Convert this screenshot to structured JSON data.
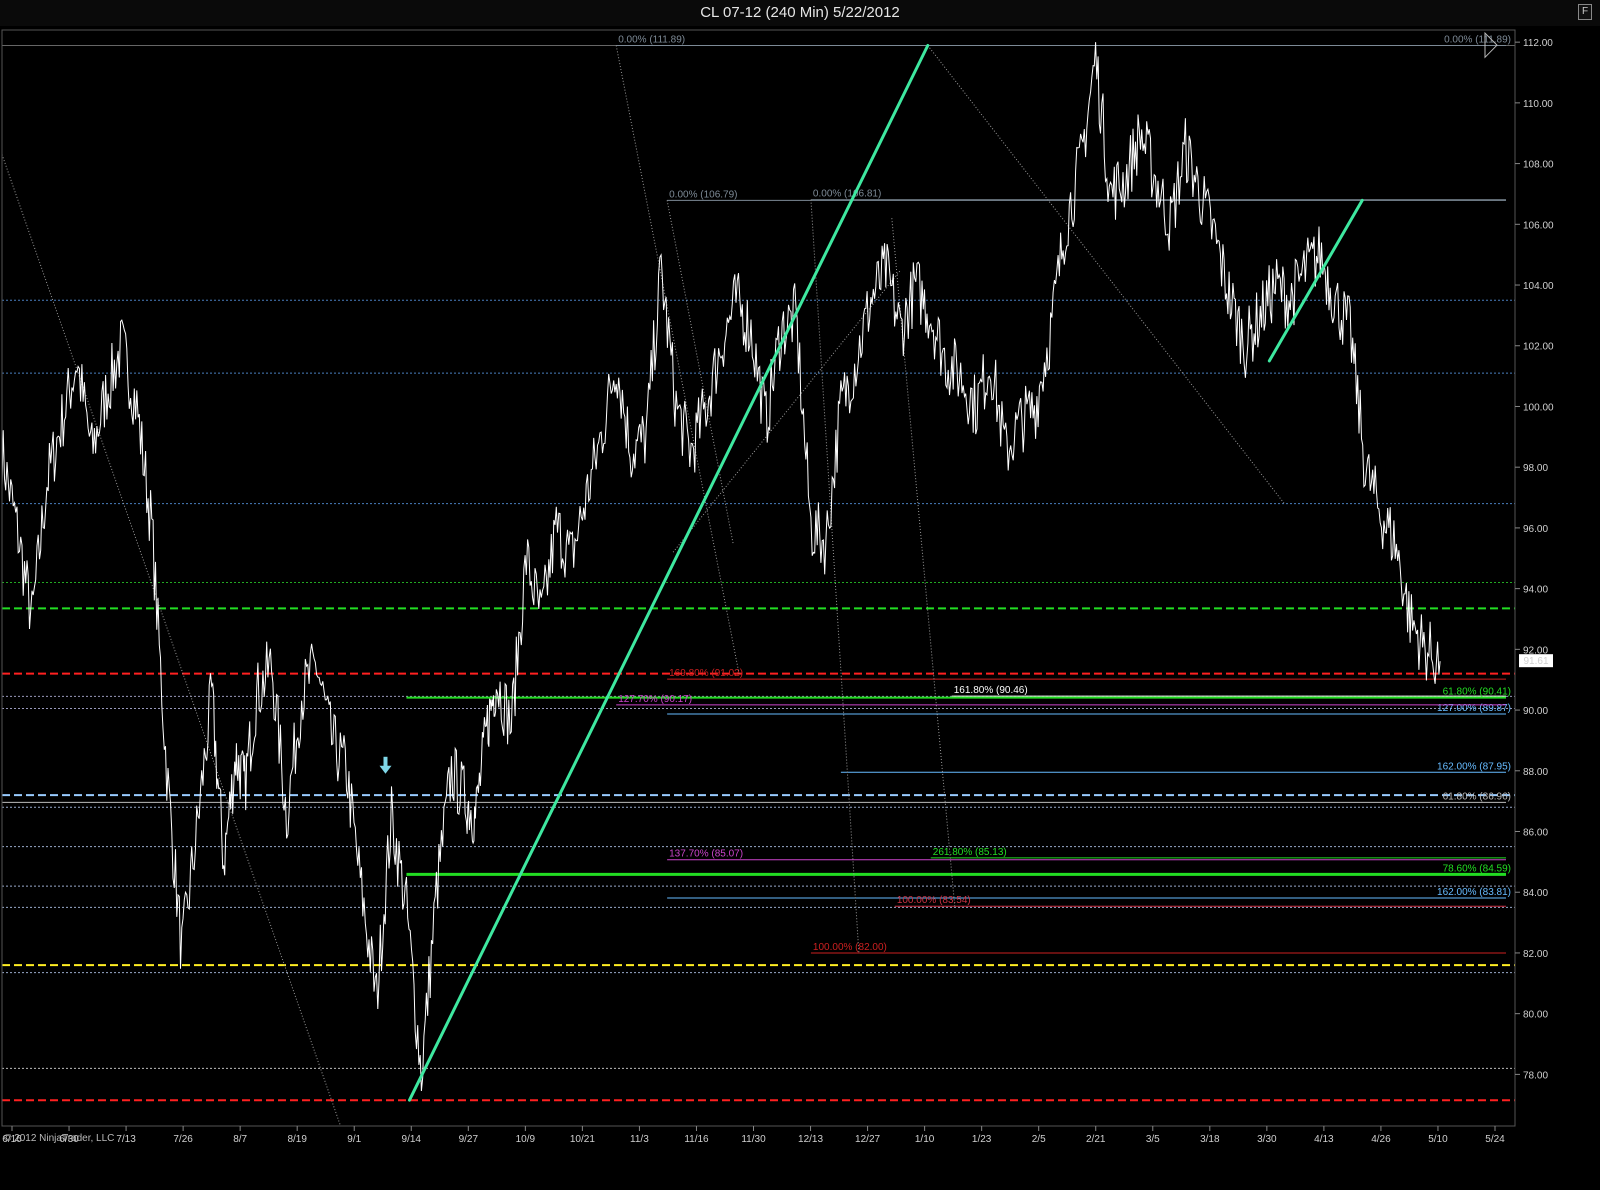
{
  "window": {
    "title": "CL 07-12 (240 Min)  5/22/2012",
    "button_label": "F"
  },
  "copyright": "© 2012 NinjaTrader, LLC",
  "colors": {
    "background": "#000000",
    "price": "#ffffff",
    "trendline": "#3ee8a0",
    "red": "#ff2020",
    "green": "#22dd22",
    "yellow": "#ffee22",
    "blue": "#66bbff"
  },
  "chart_data": {
    "type": "line",
    "ylim": [
      76.3,
      112.4
    ],
    "y_ticks": [
      78,
      80,
      82,
      84,
      86,
      88,
      90,
      92,
      94,
      96,
      98,
      100,
      102,
      104,
      106,
      108,
      110,
      112
    ],
    "y_tick_labels": [
      "78.00",
      "80.00",
      "82.00",
      "84.00",
      "86.00",
      "88.00",
      "90.00",
      "92.00",
      "94.00",
      "96.00",
      "98.00",
      "100.00",
      "102.00",
      "104.00",
      "106.00",
      "108.00",
      "110.00",
      "112.00"
    ],
    "x_ticks": [
      0,
      2,
      4,
      6,
      8,
      10,
      12,
      14,
      16,
      18,
      20,
      22,
      24,
      26,
      28,
      30,
      32,
      34,
      36,
      38,
      40,
      42,
      44,
      46,
      48
    ],
    "x_tick_labels": [
      "6/16",
      "6/30",
      "7/13",
      "7/26",
      "8/7",
      "8/19",
      "9/1",
      "9/14",
      "9/27",
      "10/9",
      "10/21",
      "11/3",
      "11/16",
      "11/30",
      "12/13",
      "12/27",
      "1/10",
      "1/23",
      "2/5",
      "2/21",
      "3/5",
      "3/18",
      "3/30",
      "4/13",
      "4/26",
      "5/10",
      "5/24"
    ],
    "xlim": [
      0,
      50.5
    ],
    "last_price": "91.61",
    "price_series": {
      "x": [
        0,
        0.5,
        1.0,
        1.5,
        2.0,
        2.5,
        3.0,
        3.5,
        4.0,
        4.5,
        5.0,
        5.5,
        6.0,
        6.5,
        7.0,
        7.4,
        7.8,
        8.1,
        8.5,
        9.0,
        9.5,
        10.0,
        10.5,
        11.0,
        11.5,
        12.0,
        12.5,
        13.0,
        13.5,
        14.0,
        14.5,
        15.0,
        15.5,
        15.8,
        16.2,
        16.5,
        17.0,
        17.5,
        18.0,
        18.5,
        19.0,
        19.5,
        20.0,
        20.5,
        21.0,
        21.5,
        22.0,
        22.5,
        23.0,
        23.5,
        24.0,
        24.5,
        25.0,
        25.5,
        26.0,
        26.5,
        27.0,
        27.5,
        28.0,
        28.5,
        29.0,
        29.5,
        30.0,
        30.5,
        31.0,
        31.5,
        32.0,
        32.5,
        33.0,
        33.5,
        34.0,
        34.5,
        35.0,
        35.5,
        36.0,
        36.5,
        37.0,
        37.5,
        38.0,
        38.5,
        39.0,
        39.5,
        40.0,
        40.5,
        41.0,
        41.5,
        42.0,
        42.5,
        43.0,
        43.5,
        44.0,
        44.5,
        45.0,
        45.5,
        46.0,
        46.5,
        47.0,
        47.5,
        48.0
      ],
      "y": [
        98.5,
        96.0,
        93.0,
        97.5,
        99.5,
        101.5,
        98.5,
        100.5,
        102.0,
        100.0,
        96.0,
        88.0,
        82.0,
        86.0,
        90.5,
        85.0,
        88.5,
        87.5,
        90.5,
        91.5,
        86.5,
        90.5,
        91.5,
        89.0,
        88.0,
        84.0,
        80.5,
        86.5,
        83.5,
        78.0,
        84.0,
        88.0,
        87.0,
        86.5,
        89.5,
        91.0,
        89.5,
        95.0,
        93.0,
        96.0,
        95.0,
        97.0,
        99.0,
        101.5,
        98.5,
        99.0,
        104.5,
        100.0,
        98.5,
        100.0,
        102.0,
        103.5,
        102.5,
        99.5,
        102.5,
        103.0,
        96.0,
        95.5,
        100.0,
        101.5,
        103.5,
        104.5,
        102.5,
        104.0,
        103.0,
        101.5,
        101.0,
        100.0,
        101.5,
        98.5,
        99.5,
        100.0,
        102.5,
        106.0,
        108.0,
        111.5,
        107.0,
        107.5,
        109.0,
        107.5,
        106.0,
        108.5,
        107.0,
        105.5,
        103.5,
        102.0,
        103.0,
        104.0,
        103.5,
        104.5,
        105.0,
        103.5,
        102.5,
        98.0,
        96.5,
        95.5,
        93.0,
        92.0,
        91.61
      ]
    },
    "horizontal_lines": [
      {
        "y": 103.5,
        "color": "#4a7fbf",
        "style": "dotted",
        "width": 1
      },
      {
        "y": 101.1,
        "color": "#4a7fbf",
        "style": "dotted",
        "width": 1
      },
      {
        "y": 96.8,
        "color": "#4a7fbf",
        "style": "dotted",
        "width": 1
      },
      {
        "y": 94.2,
        "color": "#22aa22",
        "style": "dotted",
        "width": 1
      },
      {
        "y": 93.35,
        "color": "#22dd22",
        "style": "dashed",
        "width": 2
      },
      {
        "y": 91.2,
        "color": "#ff2020",
        "style": "dashed",
        "width": 2
      },
      {
        "y": 90.45,
        "color": "#9999bb",
        "style": "dotted",
        "width": 1
      },
      {
        "y": 90.05,
        "color": "#9999bb",
        "style": "dotted",
        "width": 1
      },
      {
        "y": 87.2,
        "color": "#99ccff",
        "style": "dashed",
        "width": 2
      },
      {
        "y": 86.8,
        "color": "#99aacc",
        "style": "dotted",
        "width": 1
      },
      {
        "y": 85.5,
        "color": "#99aacc",
        "style": "dotted",
        "width": 1
      },
      {
        "y": 84.2,
        "color": "#99aacc",
        "style": "dotted",
        "width": 1
      },
      {
        "y": 83.5,
        "color": "#99aacc",
        "style": "dotted",
        "width": 1
      },
      {
        "y": 81.6,
        "color": "#ffee22",
        "style": "dashed",
        "width": 2
      },
      {
        "y": 81.35,
        "color": "#99aacc",
        "style": "dotted",
        "width": 1
      },
      {
        "y": 78.2,
        "color": "#bbbbbb",
        "style": "dotted",
        "width": 1
      },
      {
        "y": 77.15,
        "color": "#ff2020",
        "style": "dashed",
        "width": 2
      },
      {
        "y": 111.89,
        "color": "#666666",
        "style": "solid",
        "width": 1
      }
    ],
    "fib_levels": [
      {
        "label": "0.00% (111.89)",
        "y": 111.89,
        "x_start": 20.5,
        "x_end": 50.2,
        "color": "#7d8a96",
        "label_pos": "start"
      },
      {
        "label": "0.00% (111.89)",
        "y": 111.89,
        "x_start": 40,
        "x_end": 50.2,
        "color": "#7d8a96",
        "label_pos": "end"
      },
      {
        "label": "0.00% (106.79)",
        "y": 106.79,
        "x_start": 22.2,
        "x_end": 50.2,
        "color": "#7d8a96",
        "label_pos": "start"
      },
      {
        "label": "0.00% (106.81)",
        "y": 106.81,
        "x_start": 27.0,
        "x_end": 50.2,
        "color": "#7d8a96",
        "label_pos": "start"
      },
      {
        "label": "169.80% (91.02)",
        "y": 91.02,
        "x_start": 22.2,
        "x_end": 50.2,
        "color": "#cc2020",
        "label_pos": "start"
      },
      {
        "label": "161.80% (90.46)",
        "y": 90.46,
        "x_start": 31.7,
        "x_end": 50.2,
        "color": "#ffffff",
        "label_pos": "start"
      },
      {
        "label": "61.80% (90.41)",
        "y": 90.41,
        "x_start": 13.5,
        "x_end": 50.2,
        "color": "#22dd22",
        "label_pos": "end",
        "width": 2
      },
      {
        "label": "127.00% (89.87)",
        "y": 89.87,
        "x_start": 22.2,
        "x_end": 50.2,
        "color": "#66bbff",
        "label_pos": "end"
      },
      {
        "label": "127.70% (90.17)",
        "y": 90.17,
        "x_start": 20.5,
        "x_end": 50.2,
        "color": "#cc44cc",
        "label_pos": "start"
      },
      {
        "label": "162.00% (87.95)",
        "y": 87.95,
        "x_start": 28.0,
        "x_end": 50.2,
        "color": "#66bbff",
        "label_pos": "end"
      },
      {
        "label": "61.80% (86.96)",
        "y": 86.96,
        "x_start": 0,
        "x_end": 50.2,
        "color": "#bbbbbb",
        "label_pos": "end"
      },
      {
        "label": "137.70% (85.07)",
        "y": 85.07,
        "x_start": 22.2,
        "x_end": 50.2,
        "color": "#cc44cc",
        "label_pos": "start"
      },
      {
        "label": "261.80% (85.13)",
        "y": 85.13,
        "x_start": 31.0,
        "x_end": 50.2,
        "color": "#22dd22",
        "label_pos": "start"
      },
      {
        "label": "78.60% (84.59)",
        "y": 84.59,
        "x_start": 13.5,
        "x_end": 50.2,
        "color": "#22dd22",
        "label_pos": "end",
        "width": 3
      },
      {
        "label": "162.00% (83.81)",
        "y": 83.81,
        "x_start": 22.2,
        "x_end": 50.2,
        "color": "#66bbff",
        "label_pos": "end"
      },
      {
        "label": "100.00% (83.54)",
        "y": 83.54,
        "x_start": 29.8,
        "x_end": 50.2,
        "color": "#cc3344",
        "label_pos": "start"
      },
      {
        "label": "100.00% (82.00)",
        "y": 82.0,
        "x_start": 27.0,
        "x_end": 50.2,
        "color": "#cc2020",
        "label_pos": "start"
      }
    ],
    "trendlines": [
      {
        "x1": 13.6,
        "y1": 77.15,
        "x2": 30.9,
        "y2": 111.89,
        "color": "#3ee8a0",
        "width": 3
      },
      {
        "x1": 42.3,
        "y1": 101.5,
        "x2": 45.4,
        "y2": 106.79,
        "color": "#3ee8a0",
        "width": 3
      }
    ],
    "thin_lines": [
      {
        "x1": 0,
        "y1": 108.3,
        "x2": 11.3,
        "y2": 76.3
      },
      {
        "x1": 20.5,
        "y1": 111.89,
        "x2": 24.6,
        "y2": 91.2
      },
      {
        "x1": 22.2,
        "y1": 106.79,
        "x2": 24.4,
        "y2": 95.5
      },
      {
        "x1": 27.0,
        "y1": 106.81,
        "x2": 28.6,
        "y2": 82.0
      },
      {
        "x1": 29.7,
        "y1": 106.2,
        "x2": 31.8,
        "y2": 83.54
      },
      {
        "x1": 30.9,
        "y1": 111.89,
        "x2": 42.8,
        "y2": 96.8
      },
      {
        "x1": 22.4,
        "y1": 95.2,
        "x2": 30.0,
        "y2": 104.5
      }
    ],
    "arrow_marker": {
      "x": 12.8,
      "y": 88.0
    }
  }
}
